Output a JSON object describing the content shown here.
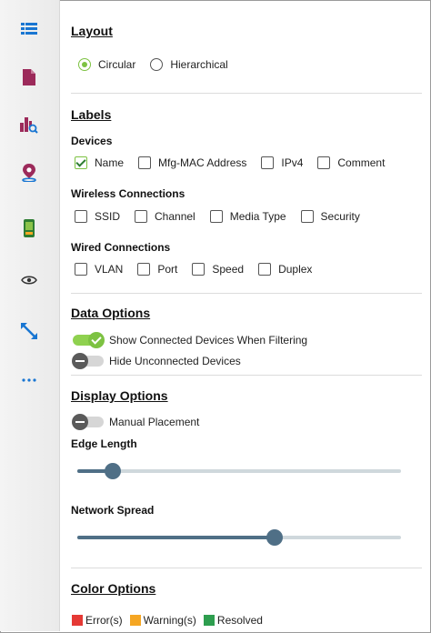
{
  "sidebar": {
    "icons": [
      {
        "name": "list-icon",
        "color": "#1976d2"
      },
      {
        "name": "document-icon",
        "color": "#9c2a5a"
      },
      {
        "name": "bar-chart-search-icon",
        "color": "#9c2a5a"
      },
      {
        "name": "location-pin-icon",
        "color": "#9c2a5a"
      },
      {
        "name": "mobile-device-icon",
        "color": "#2e7d32"
      },
      {
        "name": "eye-icon",
        "color": "#333333"
      },
      {
        "name": "resize-arrows-icon",
        "color": "#1976d2"
      },
      {
        "name": "more-icon",
        "color": "#1976d2"
      }
    ]
  },
  "layout": {
    "title": "Layout",
    "options": [
      {
        "label": "Circular",
        "selected": true
      },
      {
        "label": "Hierarchical",
        "selected": false
      }
    ]
  },
  "labels": {
    "title": "Labels",
    "devices": {
      "title": "Devices",
      "items": [
        {
          "label": "Name",
          "checked": true
        },
        {
          "label": "Mfg-MAC Address",
          "checked": false
        },
        {
          "label": "IPv4",
          "checked": false
        },
        {
          "label": "Comment",
          "checked": false
        }
      ]
    },
    "wireless": {
      "title": "Wireless Connections",
      "items": [
        {
          "label": "SSID",
          "checked": false
        },
        {
          "label": "Channel",
          "checked": false
        },
        {
          "label": "Media Type",
          "checked": false
        },
        {
          "label": "Security",
          "checked": false
        }
      ]
    },
    "wired": {
      "title": "Wired Connections",
      "items": [
        {
          "label": "VLAN",
          "checked": false
        },
        {
          "label": "Port",
          "checked": false
        },
        {
          "label": "Speed",
          "checked": false
        },
        {
          "label": "Duplex",
          "checked": false
        }
      ]
    }
  },
  "data_options": {
    "title": "Data Options",
    "show_connected": {
      "label": "Show Connected Devices When Filtering",
      "on": true
    },
    "hide_unconnected": {
      "label": "Hide Unconnected Devices",
      "on": false
    }
  },
  "display_options": {
    "title": "Display Options",
    "manual_placement": {
      "label": "Manual Placement",
      "on": false
    },
    "edge_length": {
      "label": "Edge Length",
      "fraction": 0.11
    },
    "network_spread": {
      "label": "Network Spread",
      "fraction": 0.61
    }
  },
  "color_options": {
    "title": "Color Options",
    "items": [
      {
        "label": "Error(s)",
        "color": "#e53935"
      },
      {
        "label": "Warning(s)",
        "color": "#f5a623"
      },
      {
        "label": "Resolved",
        "color": "#2e9e4f"
      }
    ]
  }
}
